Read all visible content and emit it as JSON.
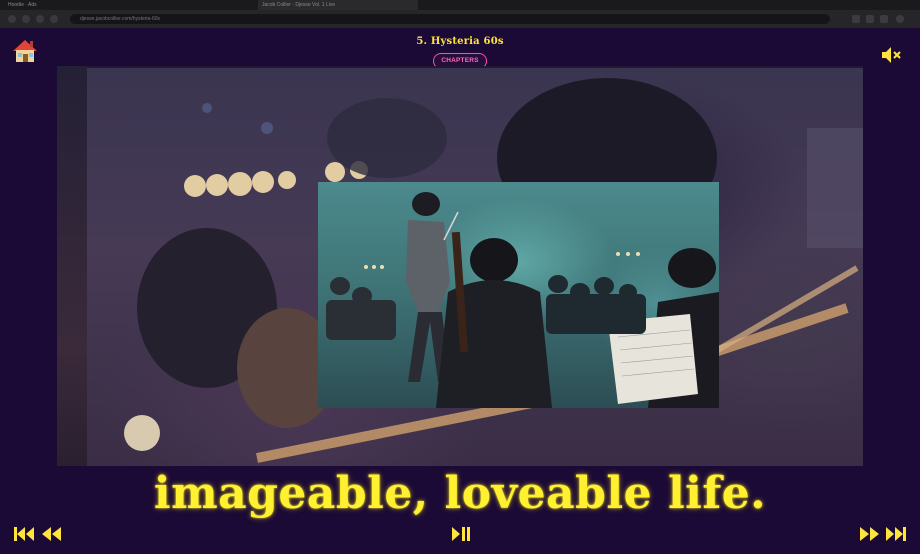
{
  "browser": {
    "tabs": [
      {
        "label": "Hoodie · Ads"
      },
      {
        "label": "Jacob Collier · Djesse Vol. 1 Live"
      }
    ],
    "url": "djesse.jacobcollier.com/hysteria-60s"
  },
  "player": {
    "chapter_title": "5. Hysteria 60s",
    "chapters_label": "CHAPTERS",
    "caption": "imageable, loveable life."
  },
  "icons": {
    "home": "house-icon",
    "mute": "speaker-muted-icon",
    "skip_start": "skip-to-start-icon",
    "rewind": "rewind-icon",
    "play_pause": "play-pause-icon",
    "fast_forward": "fast-forward-icon",
    "skip_end": "skip-to-end-icon"
  },
  "colors": {
    "accent_yellow": "#ffe53b",
    "accent_pink": "#ff4fa3",
    "background": "#1b0a36"
  }
}
